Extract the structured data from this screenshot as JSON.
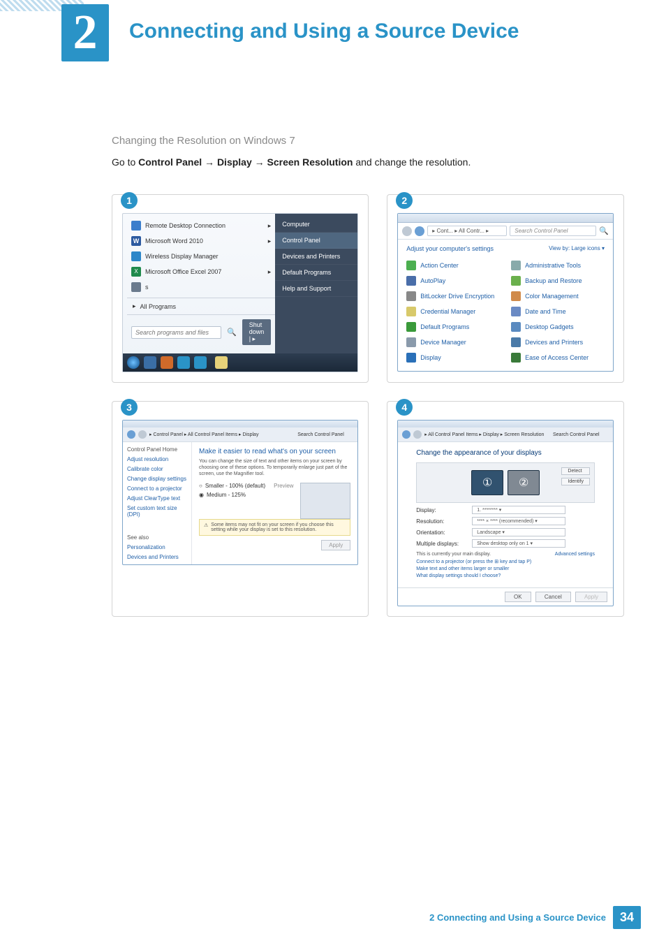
{
  "chapter": {
    "number": "2",
    "title": "Connecting and Using a Source Device"
  },
  "section": {
    "subhead": "Changing the Resolution on Windows 7",
    "instruction_pre": "Go to ",
    "cp": "Control Panel",
    "arrow": " → ",
    "disp": "Display",
    "sr": "Screen Resolution",
    "instruction_post": " and change the resolution."
  },
  "p1": {
    "left_items": [
      "Remote Desktop Connection",
      "Microsoft Word 2010",
      "Wireless Display Manager",
      "Microsoft Office Excel 2007",
      "s"
    ],
    "right_items": [
      "Computer",
      "Control Panel",
      "Devices and Printers",
      "Default Programs",
      "Help and Support"
    ],
    "all_programs": "All Programs",
    "search_placeholder": "Search programs and files",
    "shutdown": "Shut down"
  },
  "p2": {
    "crumb": "▸ Cont... ▸ All Contr... ▸",
    "search_placeholder": "Search Control Panel",
    "header": "Adjust your computer's settings",
    "viewby": "View by:   Large icons ▾",
    "items_l": [
      "Action Center",
      "AutoPlay",
      "BitLocker Drive Encryption",
      "Credential Manager",
      "Default Programs",
      "Device Manager",
      "Display"
    ],
    "items_r": [
      "Administrative Tools",
      "Backup and Restore",
      "Color Management",
      "Date and Time",
      "Desktop Gadgets",
      "Devices and Printers",
      "Ease of Access Center"
    ]
  },
  "p3": {
    "crumb": "▸ Control Panel ▸ All Control Panel Items ▸ Display",
    "search_placeholder": "Search Control Panel",
    "side": [
      "Control Panel Home",
      "Adjust resolution",
      "Calibrate color",
      "Change display settings",
      "Connect to a projector",
      "Adjust ClearType text",
      "Set custom text size (DPI)"
    ],
    "see_also": "See also",
    "see_items": [
      "Personalization",
      "Devices and Printers"
    ],
    "h": "Make it easier to read what's on your screen",
    "note": "You can change the size of text and other items on your screen by choosing one of these options. To temporarily enlarge just part of the screen, use the Magnifier tool.",
    "opt1": "Smaller - 100% (default)",
    "preview": "Preview",
    "opt2": "Medium - 125%",
    "warn": "Some items may not fit on your screen if you choose this setting while your display is set to this resolution.",
    "apply": "Apply"
  },
  "p4": {
    "crumb": "▸ All Control Panel Items ▸ Display ▸ Screen Resolution",
    "search_placeholder": "Search Control Panel",
    "h": "Change the appearance of your displays",
    "detect": "Detect",
    "identify": "Identify",
    "rows": [
      {
        "l": "Display:",
        "v": "1. ********"
      },
      {
        "l": "Resolution:",
        "v": "**** × **** (recommended)"
      },
      {
        "l": "Orientation:",
        "v": "Landscape"
      },
      {
        "l": "Multiple displays:",
        "v": "Show desktop only on 1"
      }
    ],
    "main_msg": "This is currently your main display.",
    "adv": "Advanced settings",
    "link1": "Connect to a projector (or press the ⊞ key and tap P)",
    "link2": "Make text and other items larger or smaller",
    "link3": "What display settings should I choose?",
    "ok": "OK",
    "cancel": "Cancel",
    "apply": "Apply"
  },
  "footer": {
    "text": "2 Connecting and Using a Source Device",
    "page": "34"
  }
}
